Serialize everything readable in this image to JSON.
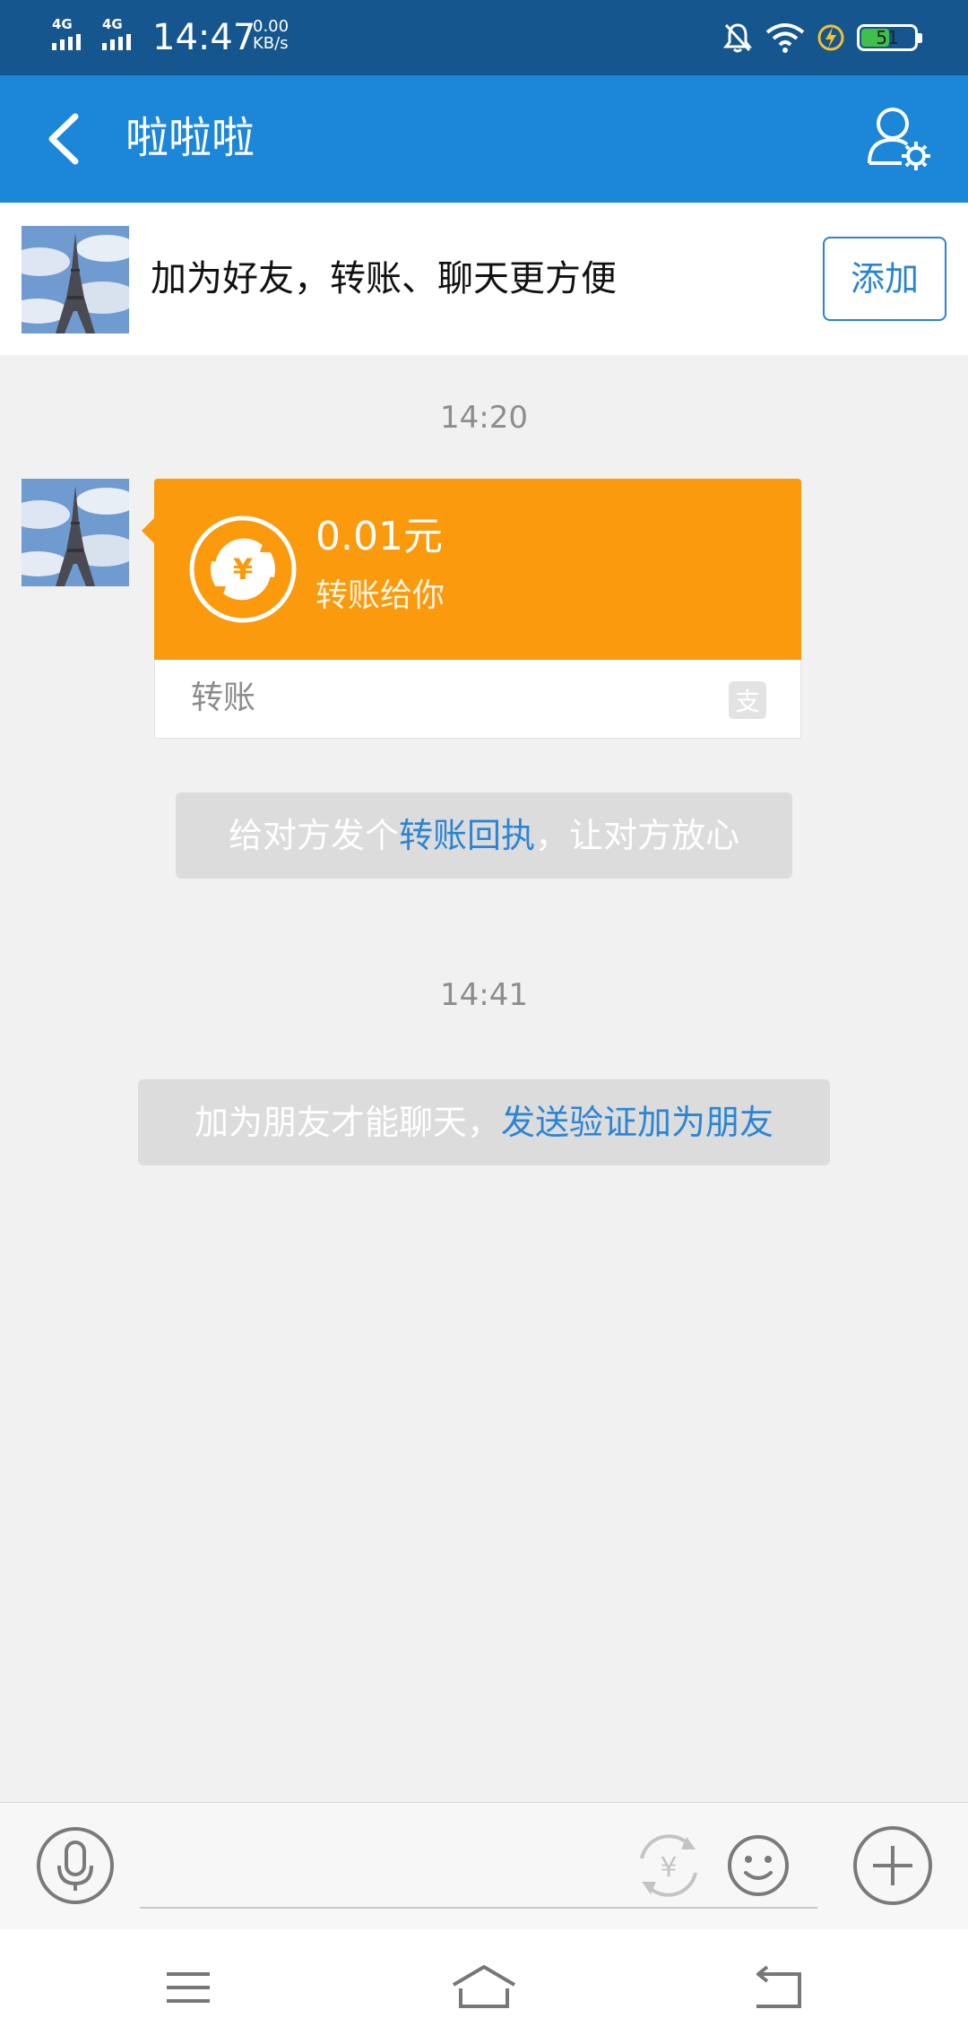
{
  "status_bar": {
    "network_1": "4G",
    "network_2": "4G",
    "time": "14:47",
    "speed_value": "0.00",
    "speed_unit": "KB/s",
    "battery": "51",
    "icons": [
      "mute-icon",
      "wifi-icon",
      "charging-icon",
      "battery-icon"
    ]
  },
  "header": {
    "title": "啦啦啦",
    "back_icon": "chevron-left-icon",
    "profile_icon": "user-settings-icon"
  },
  "banner": {
    "text": "加为好友，转账、聊天更方便",
    "button": "添加"
  },
  "chat": {
    "timestamp_1": "14:20",
    "transfer": {
      "amount": "0.01元",
      "subtitle": "转账给你",
      "label": "转账",
      "icon": "yuan-transfer-icon"
    },
    "receipt_notice": {
      "prefix": "给对方发个",
      "link": "转账回执",
      "suffix": "，让对方放心"
    },
    "timestamp_2": "14:41",
    "friend_notice": {
      "prefix": "加为朋友才能聊天，",
      "link": "发送验证加为朋友"
    }
  },
  "input_bar": {
    "placeholder": "",
    "icons": [
      "microphone-icon",
      "yuan-icon",
      "emoji-icon",
      "plus-icon"
    ]
  },
  "nav_bar": {
    "icons": [
      "menu-icon",
      "home-icon",
      "back-icon"
    ]
  },
  "colors": {
    "status_bar": "#15568f",
    "header": "#1c87d8",
    "transfer_card": "#fa9a0c",
    "link": "#2b85d6",
    "background": "#f1f1f1"
  }
}
